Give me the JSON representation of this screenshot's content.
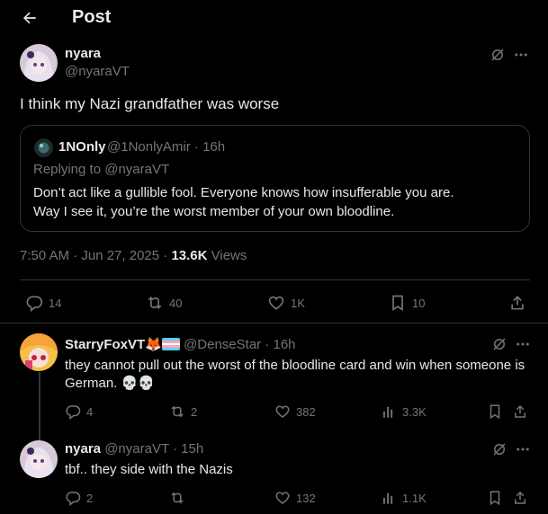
{
  "header": {
    "title": "Post"
  },
  "post": {
    "author_name": "nyara",
    "author_handle": "@nyaraVT",
    "text": "I think my Nazi grandfather was worse",
    "timestamp": "7:50 AM · Jun 27, 2025 · ",
    "views_count": "13.6K",
    "views_label": " Views",
    "stats": {
      "replies": "14",
      "reposts": "40",
      "likes": "1K",
      "bookmarks": "10"
    }
  },
  "quote": {
    "author_name": "1NOnly",
    "meta": "@1NonlyAmir · 16h",
    "replying_to": "Replying to @nyaraVT",
    "text_line1": "Don’t act like a gullible fool. Everyone knows how insufferable you are.",
    "text_line2": "Way I see it, you’re the worst member of your own bloodline."
  },
  "replies": [
    {
      "author_name": "StarryFoxVT",
      "author_emoji": "🦊",
      "meta": "@DenseStar · 16h",
      "text": "they cannot pull out the worst of the bloodline card and win when someone is German. ",
      "emojis": "💀💀",
      "stats": {
        "replies": "4",
        "reposts": "2",
        "likes": "382",
        "views": "3.3K"
      }
    },
    {
      "author_name": "nyara",
      "meta": "@nyaraVT · 15h",
      "text": "tbf.. they side with the Nazis",
      "stats": {
        "replies": "2",
        "reposts": "",
        "likes": "132",
        "views": "1.1K"
      }
    }
  ],
  "colors": {
    "bg": "#000000",
    "text": "#e7e9ea",
    "muted": "#71767b",
    "border": "#2f3336"
  }
}
